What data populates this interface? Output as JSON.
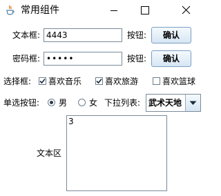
{
  "window": {
    "title": "常用组件",
    "icon": "java-cup-icon",
    "controls": [
      "minimize-icon",
      "maximize-icon",
      "close-icon"
    ]
  },
  "row_text": {
    "label": "文本框:",
    "value": "4443",
    "button_label": "按钮:",
    "button_text": "确认"
  },
  "row_password": {
    "label": "密码框:",
    "value": "•••••",
    "button_label": "按钮:",
    "button_text": "确认"
  },
  "row_checkboxes": {
    "label": "选择框:",
    "items": [
      {
        "label": "喜欢音乐",
        "checked": true
      },
      {
        "label": "喜欢旅游",
        "checked": true
      },
      {
        "label": "喜欢篮球",
        "checked": false
      }
    ]
  },
  "row_radio": {
    "label": "单选按钮:",
    "options": [
      {
        "label": "男",
        "selected": true
      },
      {
        "label": "女",
        "selected": false
      }
    ],
    "combo_label": "下拉列表:",
    "combo_value": "武术天地"
  },
  "textarea": {
    "label": "文本区",
    "value": "3"
  }
}
